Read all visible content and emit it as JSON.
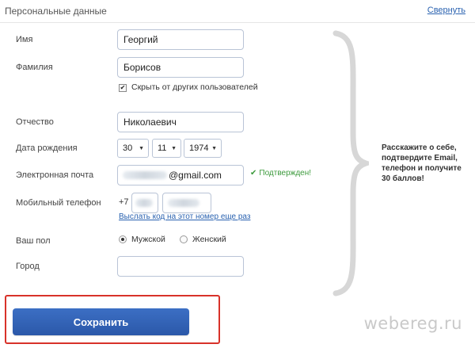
{
  "panel": {
    "title": "Персональные данные",
    "collapse_label": "Свернуть"
  },
  "fields": {
    "first_name": {
      "label": "Имя",
      "value": "Георгий"
    },
    "last_name": {
      "label": "Фамилия",
      "value": "Борисов"
    },
    "hide_checkbox": {
      "label": "Скрыть от других пользователей",
      "checked": true
    },
    "patronymic": {
      "label": "Отчество",
      "value": "Николаевич"
    },
    "birth_date": {
      "label": "Дата рождения",
      "day": "30",
      "month": "11",
      "year": "1974"
    },
    "email": {
      "label": "Электронная почта",
      "domain": "@gmail.com",
      "status": "Подтвержден!"
    },
    "phone": {
      "label": "Мобильный телефон",
      "prefix": "+7",
      "send_code_link": "Выслать код на этот номер еще раз"
    },
    "gender": {
      "label": "Ваш пол",
      "options": [
        "Мужской",
        "Женский"
      ],
      "selected": "Мужской"
    },
    "city": {
      "label": "Город",
      "value": ""
    }
  },
  "promo": {
    "text": "Расскажите о себе, подтвердите Email, телефон и получите 30 баллов!"
  },
  "actions": {
    "save_label": "Сохранить"
  },
  "watermark": "webereg.ru",
  "colors": {
    "accent": "#2b58a9",
    "link": "#2a62b0",
    "success": "#3c9a3c",
    "highlight": "#d8322a"
  },
  "icons": {
    "check": "check-icon",
    "brace": "curly-brace-icon"
  }
}
